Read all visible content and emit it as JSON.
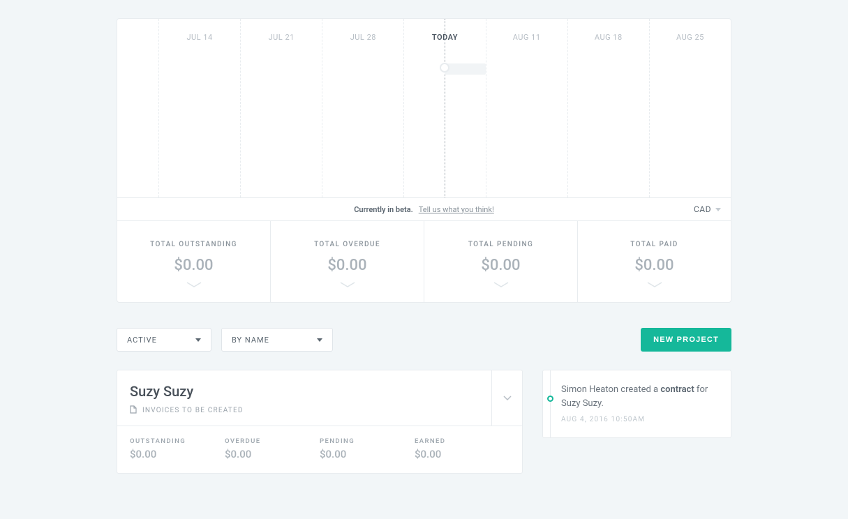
{
  "timeline": {
    "labels": [
      "JUL 14",
      "JUL 21",
      "JUL 28",
      "TODAY",
      "AUG 11",
      "AUG 18",
      "AUG 25"
    ],
    "today_index": 3
  },
  "beta": {
    "text": "Currently in beta.",
    "link": "Tell us what you think!",
    "currency": "CAD"
  },
  "totals": [
    {
      "label": "TOTAL OUTSTANDING",
      "value": "$0.00"
    },
    {
      "label": "TOTAL OVERDUE",
      "value": "$0.00"
    },
    {
      "label": "TOTAL PENDING",
      "value": "$0.00"
    },
    {
      "label": "TOTAL PAID",
      "value": "$0.00"
    }
  ],
  "filters": {
    "status": "ACTIVE",
    "sort": "BY NAME"
  },
  "new_project_label": "NEW PROJECT",
  "project": {
    "title": "Suzy Suzy",
    "subtitle": "INVOICES TO BE CREATED",
    "stats": [
      {
        "label": "OUTSTANDING",
        "value": "$0.00"
      },
      {
        "label": "OVERDUE",
        "value": "$0.00"
      },
      {
        "label": "PENDING",
        "value": "$0.00"
      },
      {
        "label": "EARNED",
        "value": "$0.00"
      }
    ]
  },
  "activity": {
    "actor": "Simon Heaton",
    "mid1": " created a ",
    "object": "contract",
    "mid2": " for ",
    "target": "Suzy Suzy.",
    "timestamp": "AUG 4, 2016 10:50AM"
  }
}
